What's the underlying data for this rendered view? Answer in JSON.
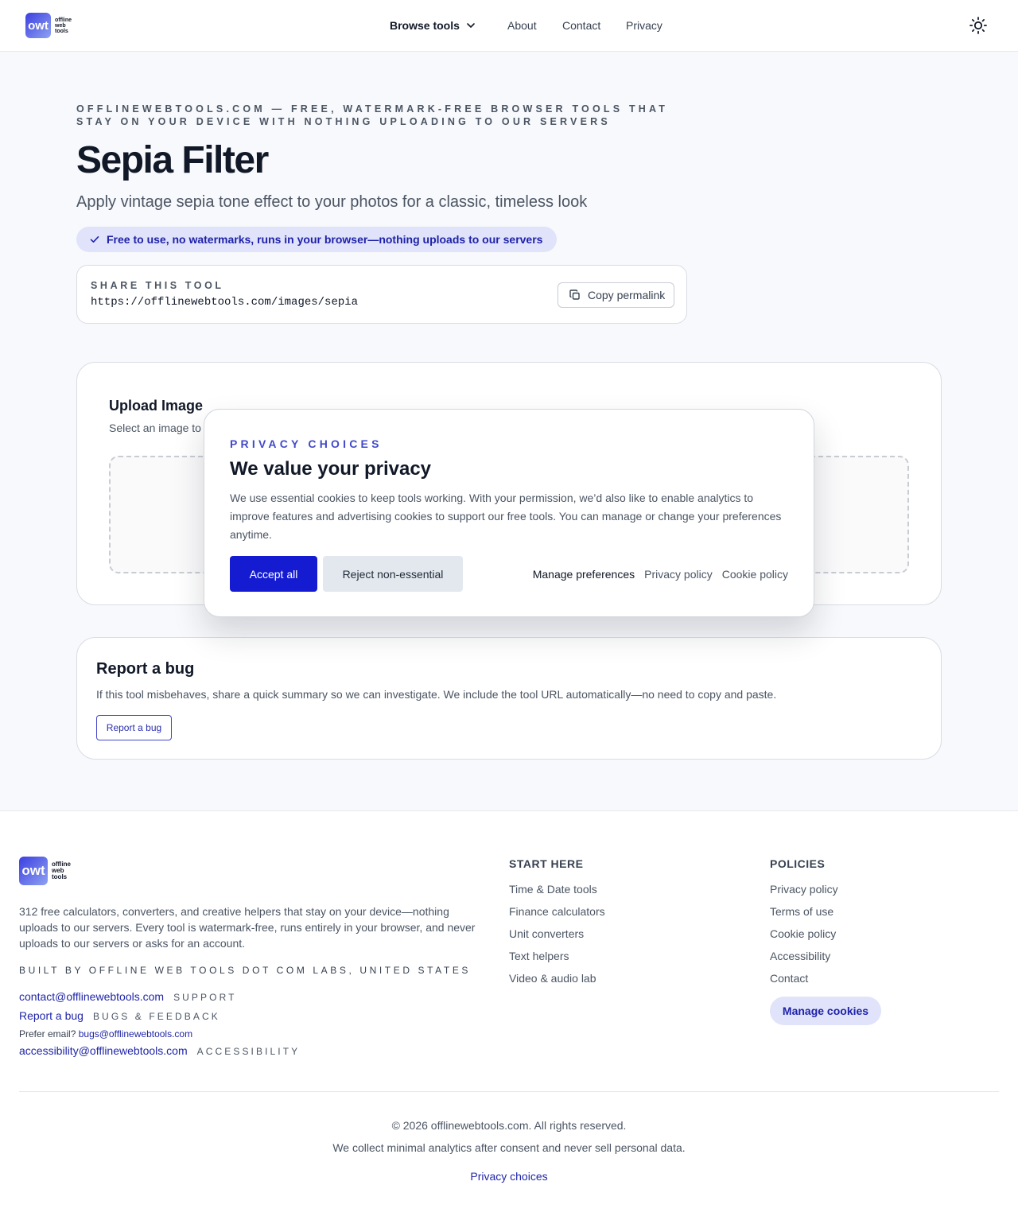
{
  "header": {
    "logo_mark": "owt",
    "logo_words": [
      "offline",
      "web",
      "tools"
    ],
    "nav": {
      "browse": "Browse tools",
      "about": "About",
      "contact": "Contact",
      "privacy": "Privacy"
    },
    "theme_icon": "sun-icon"
  },
  "hero": {
    "eyebrow": "OFFLINEWEBTOOLS.COM — FREE, WATERMARK-FREE BROWSER TOOLS THAT STAY ON YOUR DEVICE WITH NOTHING UPLOADING TO OUR SERVERS",
    "title": "Sepia Filter",
    "subtitle": "Apply vintage sepia tone effect to your photos for a classic, timeless look",
    "badge": "Free to use, no watermarks, runs in your browser—nothing uploads to our servers",
    "share": {
      "label": "SHARE THIS TOOL",
      "url": "https://offlinewebtools.com/images/sepia",
      "copy_label": "Copy permalink"
    }
  },
  "upload": {
    "title": "Upload Image",
    "subtitle": "Select an image to"
  },
  "bug": {
    "title": "Report a bug",
    "text": "If this tool misbehaves, share a quick summary so we can investigate. We include the tool URL automatically—no need to copy and paste.",
    "button": "Report a bug"
  },
  "modal": {
    "eyebrow": "PRIVACY CHOICES",
    "title": "We value your privacy",
    "text": "We use essential cookies to keep tools working. With your permission, we’d also like to enable analytics to improve features and advertising cookies to support our free tools. You can manage or change your preferences anytime.",
    "accept": "Accept all",
    "reject": "Reject non-essential",
    "manage": "Manage preferences",
    "privacy_policy": "Privacy policy",
    "cookie_policy": "Cookie policy"
  },
  "footer": {
    "description": "312 free calculators, converters, and creative helpers that stay on your device—nothing uploads to our servers. Every tool is watermark-free, runs entirely in your browser, and never uploads to our servers or asks for an account.",
    "built_by": "BUILT BY OFFLINE WEB TOOLS DOT COM LABS, UNITED STATES",
    "contact": {
      "email": "contact@offlinewebtools.com",
      "email_tag": "SUPPORT",
      "bug": "Report a bug",
      "bug_tag": "BUGS & FEEDBACK",
      "prefer": "Prefer email?",
      "bug_email": "bugs@offlinewebtools.com",
      "accessibility": "accessibility@offlinewebtools.com",
      "accessibility_tag": "ACCESSIBILITY"
    },
    "start_here": {
      "heading": "START HERE",
      "items": [
        "Time & Date tools",
        "Finance calculators",
        "Unit converters",
        "Text helpers",
        "Video & audio lab"
      ]
    },
    "policies": {
      "heading": "POLICIES",
      "items": [
        "Privacy policy",
        "Terms of use",
        "Cookie policy",
        "Accessibility",
        "Contact"
      ],
      "manage_cookies": "Manage cookies"
    },
    "copyright": "© 2026 offlinewebtools.com. All rights reserved.",
    "analytics": "We collect minimal analytics after consent and never sell personal data.",
    "privacy_choices": "Privacy choices"
  },
  "colors": {
    "accent": "#141bd1",
    "link": "#2026a8",
    "badge_bg": "#e0e3fa",
    "page_bg": "#f8f9fc"
  }
}
